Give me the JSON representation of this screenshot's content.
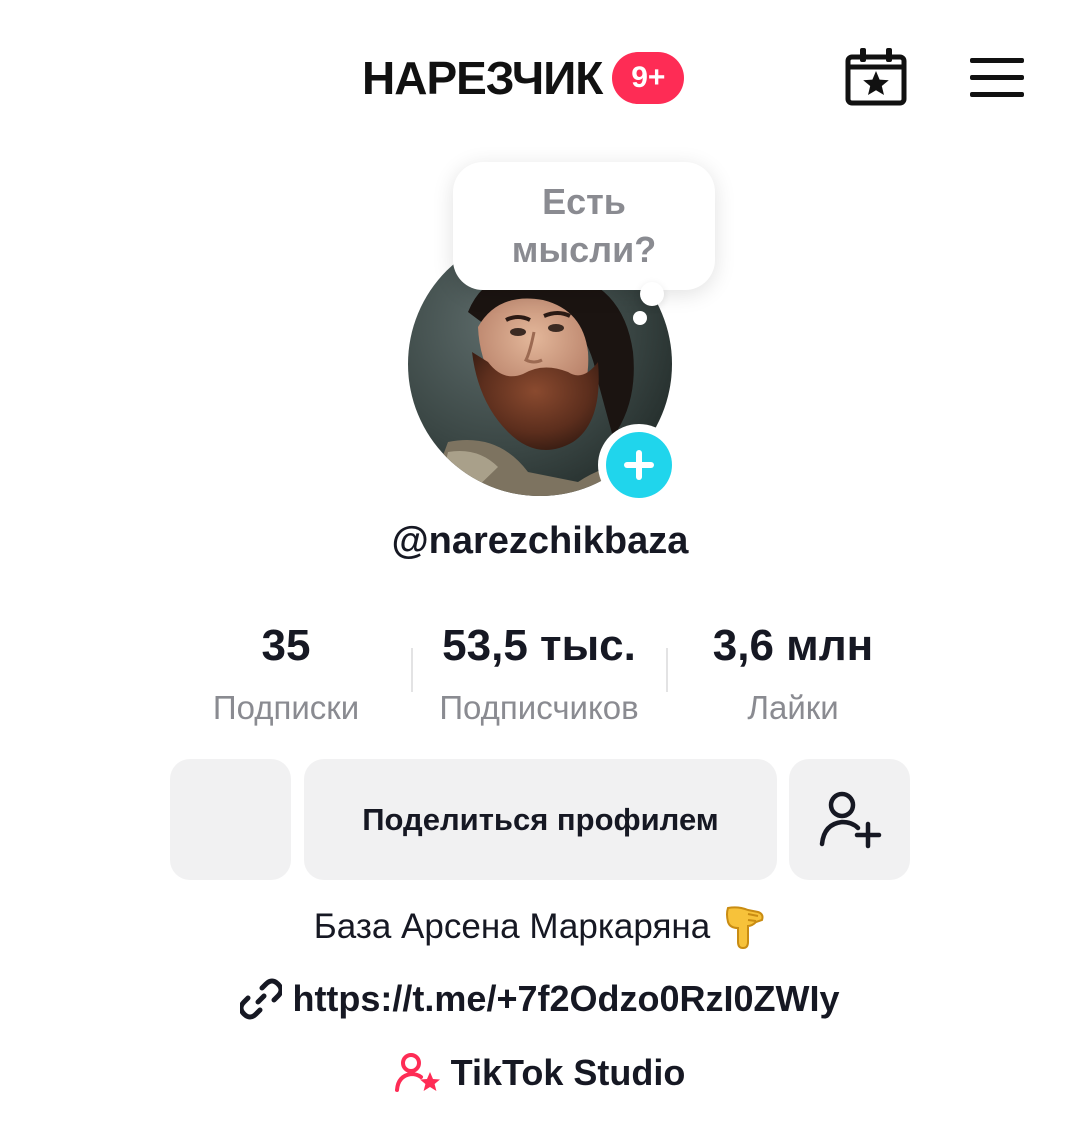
{
  "header": {
    "title": "НАРЕЗЧИК",
    "badge": "9+",
    "calendar_icon": "calendar-star-icon",
    "menu_icon": "hamburger-menu-icon",
    "badge_color": "#fe2c55"
  },
  "thought_bubble": {
    "text": "Есть мысли?"
  },
  "avatar": {
    "add_icon": "plus-icon",
    "add_color": "#20d5ec"
  },
  "profile": {
    "username": "@narezchikbaza"
  },
  "stats": [
    {
      "value": "35",
      "label": "Подписки"
    },
    {
      "value": "53,5 тыс.",
      "label": "Подписчиков"
    },
    {
      "value": "3,6 млн",
      "label": "Лайки"
    }
  ],
  "buttons": {
    "share_profile": "Поделиться профилем",
    "add_friend_icon": "add-person-icon"
  },
  "bio": {
    "text": "База Арсена Маркаряна",
    "emoji_icon": "pointing-down-icon"
  },
  "link": {
    "icon": "link-icon",
    "url": "https://t.me/+7f2Odzo0RzI0ZWIy"
  },
  "studio": {
    "icon": "tiktok-studio-icon",
    "label": "TikTok Studio",
    "icon_color": "#fe2c55"
  }
}
